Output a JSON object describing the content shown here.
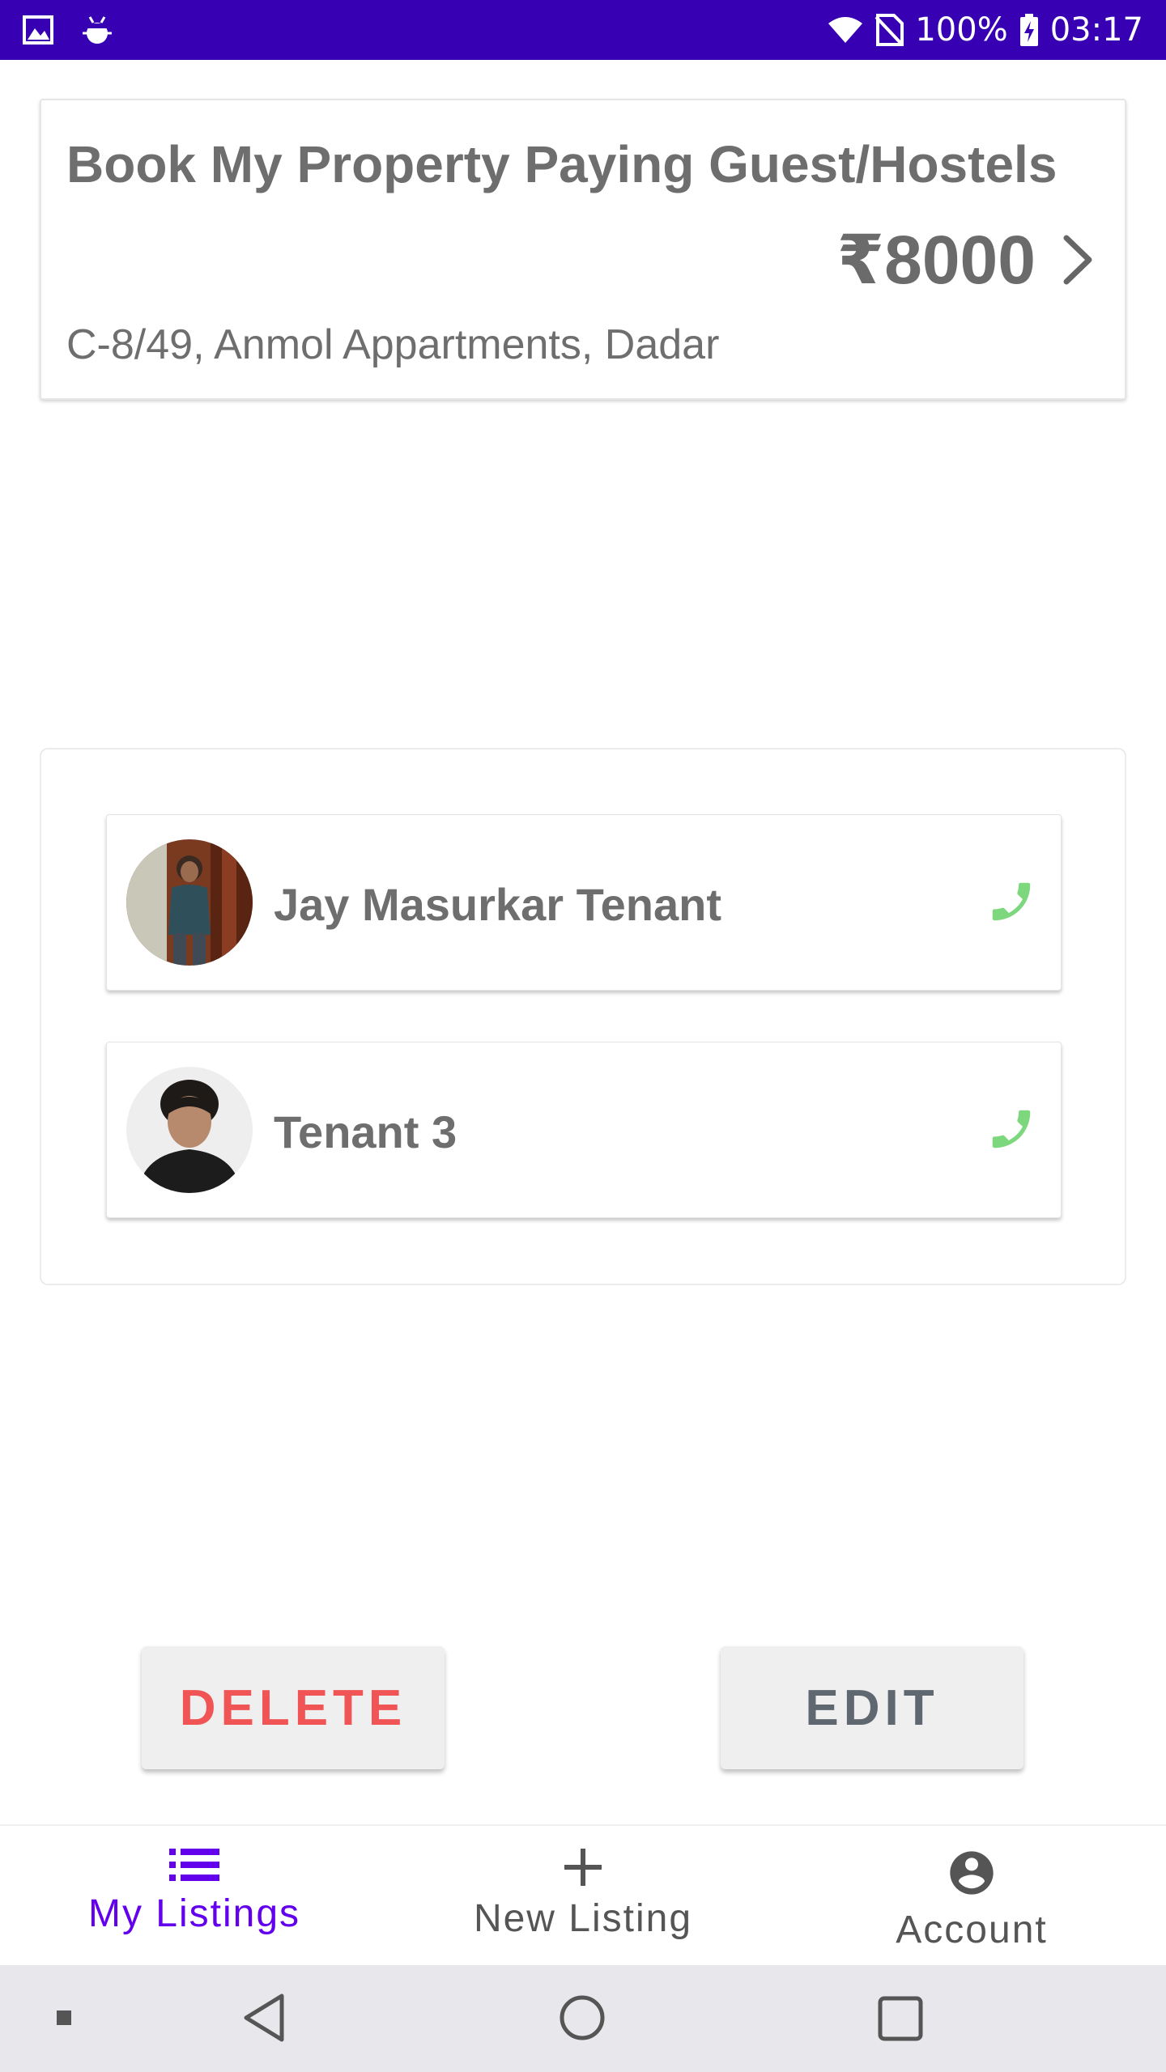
{
  "status_bar": {
    "battery": "100%",
    "time": "03:17"
  },
  "listing": {
    "title": "Book My Property Paying Guest/Hostels",
    "price": "₹8000",
    "address": "C-8/49, Anmol Appartments, Dadar"
  },
  "tenants": [
    {
      "name": "Jay Masurkar Tenant"
    },
    {
      "name": "Tenant 3"
    }
  ],
  "actions": {
    "delete_label": "DELETE",
    "edit_label": "EDIT"
  },
  "bottom_nav": {
    "items": [
      {
        "label": "My Listings",
        "icon": "list-icon",
        "active": true
      },
      {
        "label": "New Listing",
        "icon": "plus-icon",
        "active": false
      },
      {
        "label": "Account",
        "icon": "account-circle-icon",
        "active": false
      }
    ]
  },
  "colors": {
    "status_bar": "#3700b3",
    "accent": "#6200ee",
    "delete": "#f05454",
    "phone": "#7dd87d"
  }
}
